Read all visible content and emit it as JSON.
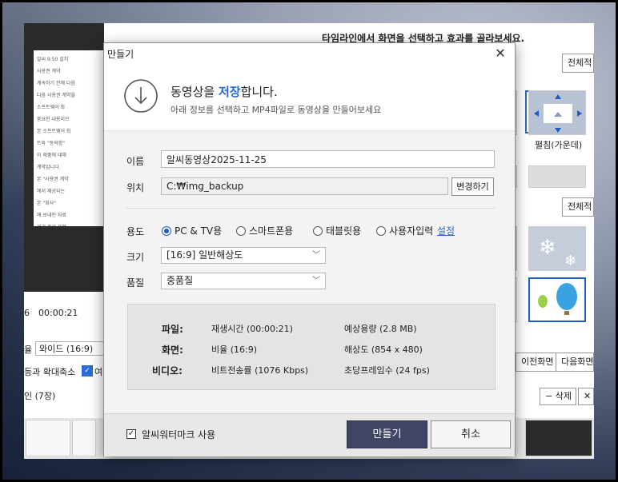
{
  "background_app": {
    "panel_heading": "타임라인에서 화면을 선택하고 효과를 골라보세요.",
    "btn_all_1": "전체적",
    "btn_all_2": "전체적",
    "tile_spread_label": "펼침(가운데)",
    "time_prefix": "6",
    "time_current": "00:00:21",
    "aspect_prefix": "율",
    "aspect_select": "와이드 (16:9)",
    "zoom_label": "등과 확대축소",
    "zoom_suffix": "여",
    "scene_count": "인 (7장)",
    "prev_scene": "이전화면",
    "next_scene": "다음화면",
    "delete_btn": "− 삭제",
    "extra_btn": "✕ 전",
    "preview_lines": [
      "알씨 9.50 설치",
      "사용권 계약",
      "계속하기 전에 다음",
      "다음 사용권 계약을",
      "소프트웨어 최",
      "중요한 내용이므",
      "본 소프트웨어 최",
      "트와 \"동의함\"",
      "이 제품에 대해",
      "계약입니다.",
      "본 \"사용권 계약",
      "에서 제공되는",
      "본 \"회사\"",
      "에 보내진 자료",
      "여기 중이 포함",
      "\"사용자\"는 본",
      "하기나 실행함"
    ]
  },
  "dialog": {
    "title": "만들기",
    "header_title_pre": "동영상을 ",
    "header_title_hl": "저장",
    "header_title_post": "합니다.",
    "header_sub": "아래 정보를 선택하고 MP4파일로 동영상을 만들어보세요",
    "name_label": "이름",
    "name_value": "알씨동영상2025-11-25",
    "location_label": "위치",
    "location_value": "C:₩img_backup",
    "change_button": "변경하기",
    "purpose_label": "용도",
    "purpose_options": [
      "PC & TV용",
      "스마트폰용",
      "태블릿용",
      "사용자입력"
    ],
    "purpose_selected": 0,
    "setting_link": "설정",
    "size_label": "크기",
    "size_value": "[16:9] 일반해상도",
    "quality_label": "품질",
    "quality_value": "중품질",
    "info": {
      "file_label": "파일:",
      "file_v1": "재생시간 (00:00:21)",
      "file_v2": "예상용량 (2.8 MB)",
      "screen_label": "화면:",
      "screen_v1": "비율 (16:9)",
      "screen_v2": "해상도 (854 x 480)",
      "video_label": "비디오:",
      "video_v1": "비트전송률 (1076 Kbps)",
      "video_v2": "초당프레임수 (24 fps)"
    },
    "watermark_label": "알씨워터마크 사용",
    "watermark_checked": true,
    "make_button": "만들기",
    "cancel_button": "취소"
  },
  "colors": {
    "accent": "#2a67c9",
    "primary_button": "#3f4563",
    "dialog_bg": "#f3f3f3"
  }
}
